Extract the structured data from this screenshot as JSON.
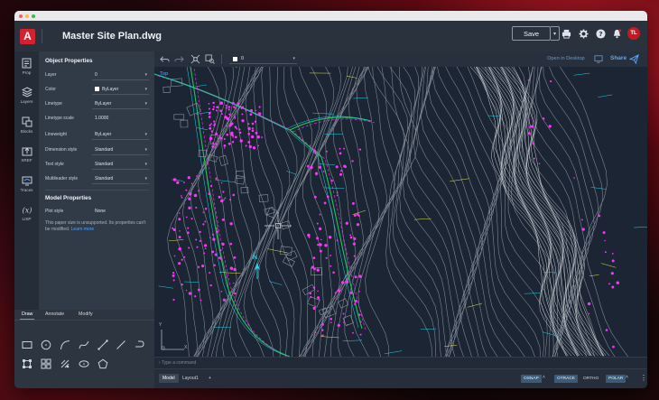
{
  "window": {
    "dots": [
      "#ff5f57",
      "#febc2e",
      "#28c840"
    ]
  },
  "header": {
    "logo_letter": "A",
    "title": "Master Site Plan.dwg",
    "save_label": "Save",
    "avatar_initials": "TL"
  },
  "rail": {
    "items": [
      {
        "label": "Prop",
        "icon": "properties-icon"
      },
      {
        "label": "Layers",
        "icon": "layers-icon"
      },
      {
        "label": "Blocks",
        "icon": "blocks-icon"
      },
      {
        "label": "XREF",
        "icon": "xref-icon"
      },
      {
        "label": "Traces",
        "icon": "traces-icon"
      },
      {
        "label": "LISP",
        "icon": "lisp-icon"
      }
    ]
  },
  "object_properties": {
    "heading": "Object Properties",
    "rows": [
      {
        "label": "Layer",
        "value": "0"
      },
      {
        "label": "Color",
        "value": "ByLayer"
      },
      {
        "label": "Linetype",
        "value": "ByLayer"
      },
      {
        "label": "Linetype scale",
        "value": "1.0000"
      },
      {
        "label": "Lineweight",
        "value": "ByLayer"
      },
      {
        "label": "Dimension style",
        "value": "Standard"
      },
      {
        "label": "Text style",
        "value": "Standard"
      },
      {
        "label": "Multileader style",
        "value": "Standard"
      }
    ]
  },
  "model_properties": {
    "heading": "Model Properties",
    "plot_style_label": "Plot style",
    "plot_style_value": "None",
    "note": "This paper size is unsupported. Its properties can't be modified.",
    "learn_more": "Learn more"
  },
  "tool_palette": {
    "tabs": [
      "Draw",
      "Annotate",
      "Modify"
    ],
    "active_tab": "Draw",
    "tools": [
      "rectangle-tool-icon",
      "circle-tool-icon",
      "arc-tool-icon",
      "spline-tool-icon",
      "polyline-tool-icon",
      "line-tool-icon",
      "undo-curve-tool-icon",
      "boundary-tool-icon",
      "grid-tool-icon",
      "hatch-tool-icon",
      "ellipse-tool-icon",
      "polygon-tool-icon"
    ]
  },
  "canvas_toolbar": {
    "layer_value": "0",
    "open_in_desktop": "Open in Desktop",
    "share": "Share"
  },
  "canvas": {
    "view_label": "Top",
    "north_label": "N",
    "axis_x": "X",
    "axis_y": "Y",
    "colors": {
      "background": "#1c2533",
      "contour": "#9aa3ad",
      "magenta": "#ff33ff",
      "road_green": "#22c55e",
      "cyan": "#22d3ee",
      "yellow": "#e5e35a"
    }
  },
  "command_line": {
    "placeholder": "Type a command"
  },
  "status_bar": {
    "tabs": [
      "Model",
      "Layout1"
    ],
    "active_tab": "Model",
    "add_label": "+",
    "toggles": [
      {
        "label": "OSNAP",
        "on": true
      },
      {
        "label": "OTRACK",
        "on": true
      },
      {
        "label": "ORTHO",
        "on": false
      },
      {
        "label": "POLAR",
        "on": true
      }
    ]
  }
}
